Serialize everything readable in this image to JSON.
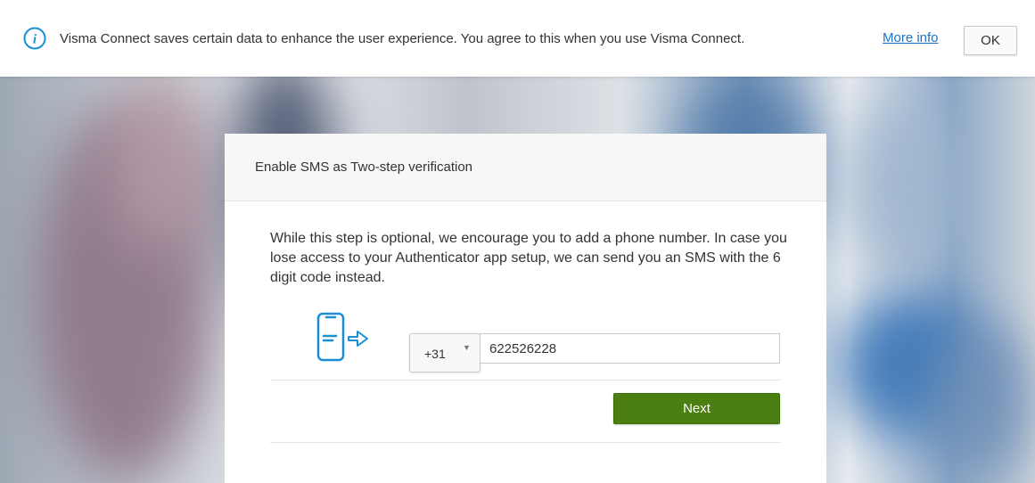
{
  "banner": {
    "message": "Visma Connect saves certain data to enhance the user experience. You agree to this when you use Visma Connect.",
    "more_info_label": "More info",
    "ok_label": "OK",
    "info_icon": "info-icon"
  },
  "dialog": {
    "title": "Enable SMS as Two-step verification",
    "description": "While this step is optional, we encourage you to add a phone number. In case you lose access to your Authenticator app setup, we can send you an SMS with the 6 digit code instead.",
    "illustration_icon": "phone-arrow-icon",
    "country_code": "+31",
    "phone_number": "622526228",
    "next_label": "Next"
  },
  "colors": {
    "accent_blue": "#1a73c7",
    "button_green": "#4c7f12",
    "icon_blue": "#1a8fd6"
  }
}
